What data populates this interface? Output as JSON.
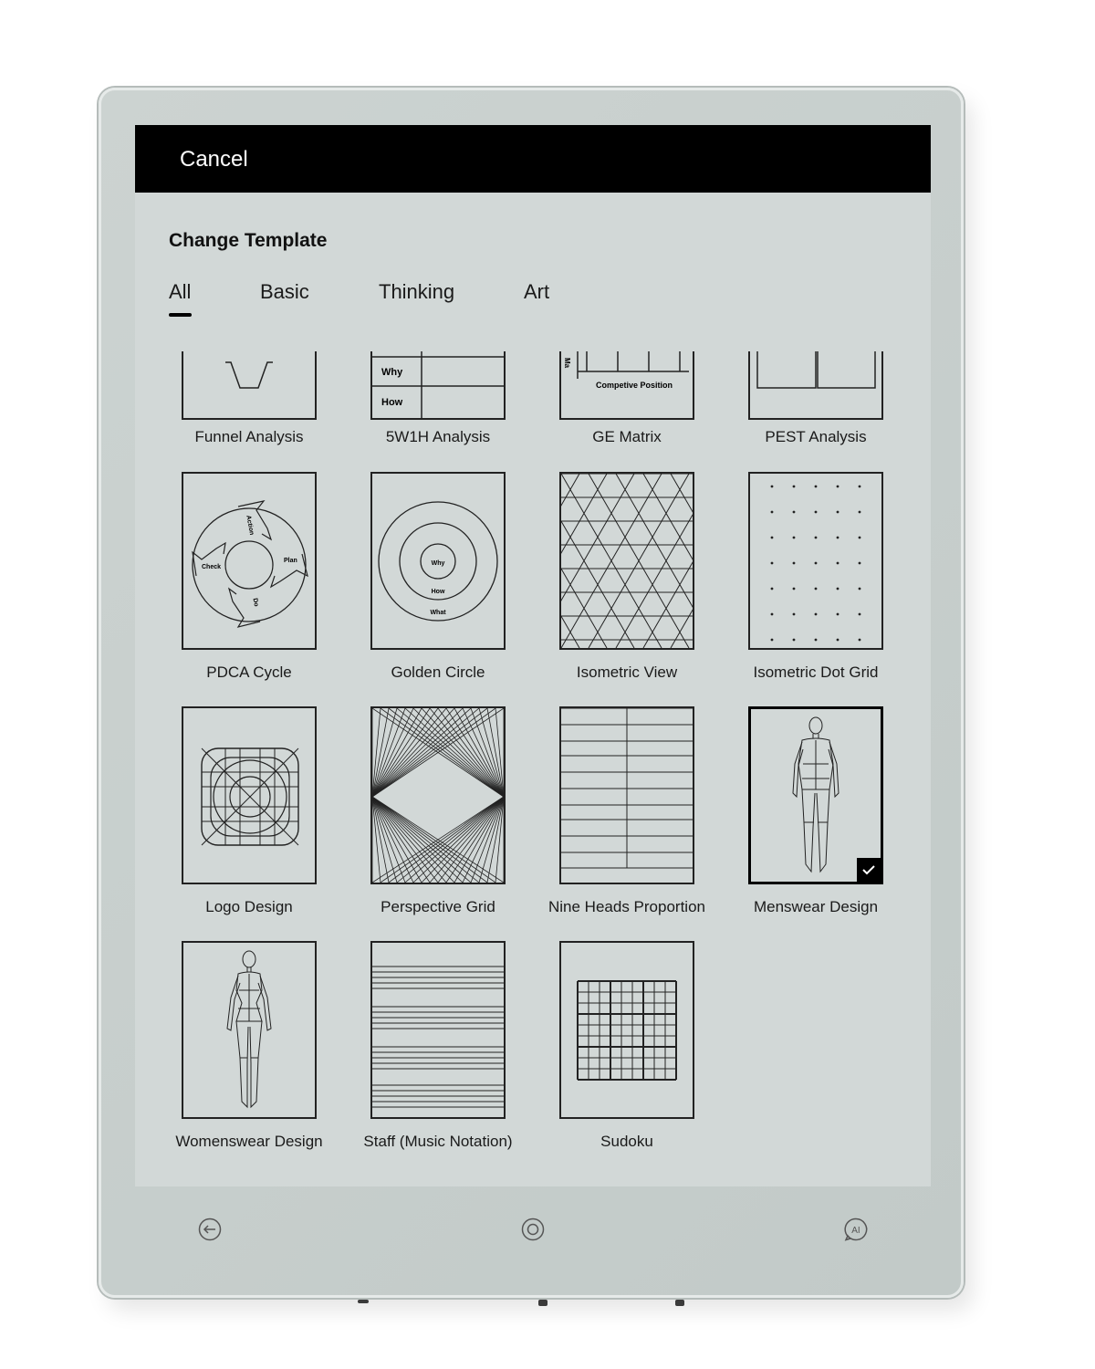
{
  "header": {
    "cancel_label": "Cancel"
  },
  "title": "Change Template",
  "tabs": [
    {
      "label": "All",
      "active": true
    },
    {
      "label": "Basic",
      "active": false
    },
    {
      "label": "Thinking",
      "active": false
    },
    {
      "label": "Art",
      "active": false
    }
  ],
  "templates": [
    {
      "name": "Funnel Analysis",
      "icon": "funnel-icon"
    },
    {
      "name": "5W1H Analysis",
      "icon": "table-icon",
      "thumb_text": [
        "Why",
        "How"
      ]
    },
    {
      "name": "GE Matrix",
      "icon": "matrix-icon",
      "thumb_text": [
        "Competive Position",
        "Ma"
      ]
    },
    {
      "name": "PEST Analysis",
      "icon": "quad-icon"
    },
    {
      "name": "PDCA Cycle",
      "icon": "cycle-icon",
      "thumb_text": [
        "Action",
        "Plan",
        "Check",
        "Do"
      ]
    },
    {
      "name": "Golden Circle",
      "icon": "target-icon",
      "thumb_text": [
        "Why",
        "How",
        "What"
      ]
    },
    {
      "name": "Isometric View",
      "icon": "isometric-icon"
    },
    {
      "name": "Isometric Dot Grid",
      "icon": "dot-grid-icon"
    },
    {
      "name": "Logo Design",
      "icon": "logo-grid-icon"
    },
    {
      "name": "Perspective Grid",
      "icon": "perspective-icon"
    },
    {
      "name": "Nine Heads Proportion",
      "icon": "lines-icon"
    },
    {
      "name": "Menswear Design",
      "icon": "figure-icon",
      "selected": true
    },
    {
      "name": "Womenswear Design",
      "icon": "figure-icon"
    },
    {
      "name": "Staff (Music Notation)",
      "icon": "staff-icon"
    },
    {
      "name": "Sudoku",
      "icon": "sudoku-icon"
    }
  ],
  "nav": [
    {
      "icon": "back-arrow-icon"
    },
    {
      "icon": "home-circle-icon"
    },
    {
      "icon": "ai-assistant-icon",
      "label": "AI"
    }
  ]
}
